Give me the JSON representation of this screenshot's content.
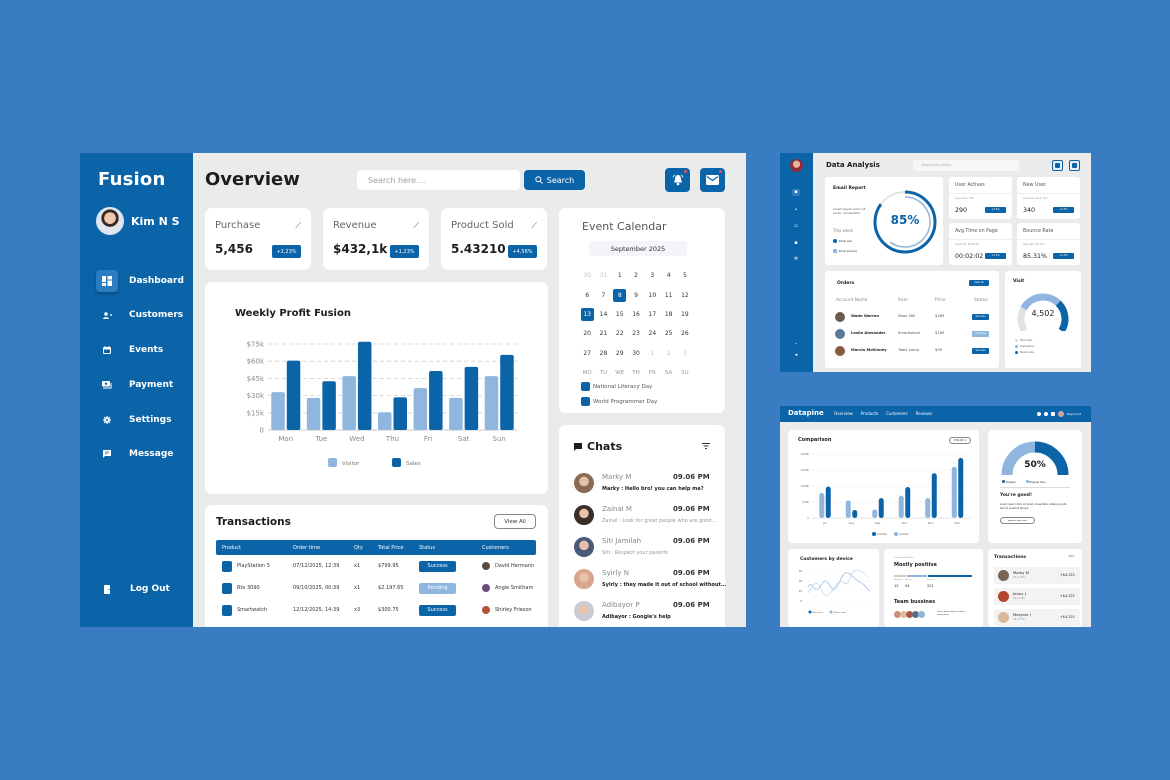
{
  "colors": {
    "background": "#3a7cc2",
    "primary": "#0b63a8",
    "light_blue": "#8fb6de",
    "panel": "#ebebeb",
    "pending": "#8fb6de"
  },
  "main": {
    "brand": "Fusion",
    "user": {
      "name": "Kim N S"
    },
    "sidebar": {
      "items": [
        {
          "label": "Dashboard",
          "icon": "dashboard-icon",
          "active": true
        },
        {
          "label": "Customers",
          "icon": "users-icon"
        },
        {
          "label": "Events",
          "icon": "calendar-icon"
        },
        {
          "label": "Payment",
          "icon": "payment-icon"
        },
        {
          "label": "Settings",
          "icon": "gear-icon"
        },
        {
          "label": "Message",
          "icon": "message-icon"
        }
      ],
      "logout": "Log Out"
    },
    "header": {
      "title": "Overview",
      "search_placeholder": "Search here....",
      "search_button": "Search",
      "notification_icon": "bell-icon",
      "mail_icon": "mail-icon"
    },
    "stats": [
      {
        "label": "Purchase",
        "value": "5,456",
        "badge": "+2,23%"
      },
      {
        "label": "Revenue",
        "value": "$432,1k",
        "badge": "+1,23%"
      },
      {
        "label": "Product Sold",
        "value": "5.43210",
        "badge": "+4,56%"
      }
    ],
    "calendar": {
      "title": "Event Calendar",
      "month": "September 2025",
      "weeks": [
        [
          {
            "d": "30",
            "m": true
          },
          {
            "d": "31",
            "m": true
          },
          {
            "d": "1"
          },
          {
            "d": "2"
          },
          {
            "d": "3"
          },
          {
            "d": "4"
          },
          {
            "d": "5"
          }
        ],
        [
          {
            "d": "6"
          },
          {
            "d": "7"
          },
          {
            "d": "8",
            "s": true
          },
          {
            "d": "9"
          },
          {
            "d": "10"
          },
          {
            "d": "11"
          },
          {
            "d": "12"
          }
        ],
        [
          {
            "d": "13",
            "s": true
          },
          {
            "d": "14"
          },
          {
            "d": "15"
          },
          {
            "d": "16"
          },
          {
            "d": "17"
          },
          {
            "d": "18"
          },
          {
            "d": "19"
          }
        ],
        [
          {
            "d": "20"
          },
          {
            "d": "21"
          },
          {
            "d": "22"
          },
          {
            "d": "23"
          },
          {
            "d": "24"
          },
          {
            "d": "25"
          },
          {
            "d": "26"
          }
        ],
        [
          {
            "d": "27"
          },
          {
            "d": "28"
          },
          {
            "d": "29"
          },
          {
            "d": "30"
          },
          {
            "d": "1",
            "m": true
          },
          {
            "d": "2",
            "m": true
          },
          {
            "d": "3",
            "m": true
          }
        ]
      ],
      "weekdays": [
        "MO",
        "TU",
        "WE",
        "TH",
        "FR",
        "SA",
        "SU"
      ],
      "events": [
        "National Literacy Day",
        "World Programmer Day"
      ]
    },
    "chats": {
      "title": "Chats",
      "items": [
        {
          "name": "Marky M",
          "time": "09.06 PM",
          "message": "Marky : Hello bro! you can help me?",
          "unread": true,
          "avatar": "#8a6b55"
        },
        {
          "name": "Zainal M",
          "time": "09.06 PM",
          "message": "Zainal : Look for great people who are good...",
          "unread": false,
          "avatar": "#3b2e2a"
        },
        {
          "name": "Siti Jamilah",
          "time": "09.06 PM",
          "message": "Siti : Respect your parents",
          "unread": false,
          "avatar": "#4a5a78"
        },
        {
          "name": "Syirly N",
          "time": "09.06 PM",
          "message": "Syirly : they made it out of school without ...",
          "unread": true,
          "avatar": "#d9a58f"
        },
        {
          "name": "Adibayor P",
          "time": "09.06 PM",
          "message": "Adibayor : Google's help",
          "unread": true,
          "avatar": "#c9ccd2"
        }
      ]
    },
    "transactions": {
      "title": "Transactions",
      "view_all": "View All",
      "columns": [
        "Product",
        "Order time",
        "Qty",
        "Total Price",
        "Status",
        "Customers"
      ],
      "rows": [
        {
          "product": "PlayStation 5",
          "time": "07/12/2025, 12:39",
          "qty": "x1",
          "price": "$799.95",
          "status": "Success",
          "customer": "David Hermann",
          "cust_color": "#5b4a40"
        },
        {
          "product": "Rtx 3090",
          "time": "09/10/2025, 00:39",
          "qty": "x1",
          "price": "$2.197.65",
          "status": "Pending",
          "customer": "Angie Smitham",
          "cust_color": "#6b4d7a"
        },
        {
          "product": "Smartwatch",
          "time": "12/12/2025, 14:39",
          "qty": "x3",
          "price": "$300.75",
          "status": "Success",
          "customer": "Shirley Frieson",
          "cust_color": "#b5533a"
        }
      ]
    }
  },
  "chart_data": [
    {
      "type": "bar",
      "title": "Weekly Profit Fusion",
      "categories": [
        "Mon",
        "Tue",
        "Wed",
        "Thu",
        "Fri",
        "Sat",
        "Sun"
      ],
      "series": [
        {
          "name": "Visitor",
          "color": "#8fb6de",
          "values": [
            33,
            28,
            47,
            15.5,
            36.5,
            28,
            47
          ]
        },
        {
          "name": "Sales",
          "color": "#0b63a8",
          "values": [
            60.5,
            42.5,
            77,
            28.5,
            51.5,
            55,
            65.5
          ]
        }
      ],
      "y_ticks": [
        "0",
        "$15k",
        "$30k",
        "$45k",
        "$60k",
        "$75k"
      ],
      "ylim": [
        0,
        75
      ],
      "yunit": "$k",
      "grid": true,
      "legend": "bottom"
    },
    {
      "type": "bar",
      "title": "Comparison",
      "categories": [
        "Jul",
        "Aug",
        "Sep",
        "Oct",
        "Nov",
        "Dec"
      ],
      "series": [
        {
          "name": "Last Year",
          "color": "#8fb6de",
          "values": [
            78,
            55,
            27,
            70,
            62,
            160
          ]
        },
        {
          "name": "This Year",
          "color": "#0b63a8",
          "values": [
            98,
            25,
            62,
            97,
            140,
            188
          ]
        }
      ],
      "y_ticks": [
        "0",
        "$50k",
        "$100k",
        "$150k",
        "$200k"
      ],
      "ylim": [
        0,
        200
      ],
      "grid": true,
      "legend": "bottom"
    }
  ],
  "data_analysis": {
    "title": "Data Analysis",
    "search_placeholder": "Search anything...",
    "email": {
      "title": "Email Report",
      "desc": "Lorem ipsum dolor sit amet, consectetur",
      "week": "This week",
      "percent": "85%",
      "progress": 0.85,
      "legend": [
        "Email sent",
        "Email pending"
      ]
    },
    "stats": [
      {
        "title": "User Actives",
        "sub": "Avg.users: 320",
        "value": "290",
        "badge": "+2.3%"
      },
      {
        "title": "New User",
        "sub": "Avg.new users: 354",
        "value": "340",
        "badge": "+2.3%"
      },
      {
        "title": "Avg.Time on Page",
        "sub": "Avg.time: 00:03:05",
        "value": "00:02:02",
        "badge": "+2.3%"
      },
      {
        "title": "Bounce Rate",
        "sub": "Avg.rate: 85.31%",
        "value": "85.31%",
        "badge": "+2.3%"
      }
    ],
    "orders": {
      "title": "Orders",
      "button": "View All",
      "columns": [
        "Account Name",
        "Item",
        "Price",
        "Status"
      ],
      "rows": [
        {
          "name": "Wade Warren",
          "item": "Xbox 360",
          "price": "$489",
          "status": "Success",
          "color": "#6a5a4f"
        },
        {
          "name": "Leslie Alexander",
          "item": "Smartwatch",
          "price": "$189",
          "status": "Pending",
          "color": "#5a7a9a"
        },
        {
          "name": "Marvin McKinney",
          "item": "Table Lamp",
          "price": "$99",
          "status": "Success",
          "color": "#8a5a45"
        }
      ]
    },
    "visit": {
      "title": "Visit",
      "value": "4,502",
      "legend": [
        "Total users",
        "Impressions",
        "Bounce rate"
      ]
    }
  },
  "datapine": {
    "logo": "Datapine",
    "nav": [
      "Overview",
      "Products",
      "Customers",
      "Reviews"
    ],
    "user": "Raymond",
    "comparison_select": "6 Month",
    "gauge": {
      "percent": "50%",
      "value": 0.5,
      "legend": [
        "Progress",
        "Progress done"
      ],
      "title": "You're good!",
      "desc": "Lorem ipsum dolor sit amet, consectetur adipiscing elit. Sed do eiusmod tempor.",
      "button": "Improve your score"
    },
    "device": {
      "title": "Customers by device",
      "y_ticks": [
        "0",
        "15",
        "30",
        "45"
      ],
      "legend": [
        "Web sales",
        "Offline sales"
      ]
    },
    "sentiment": {
      "caption": "Customer feedback",
      "title": "Mostly positive",
      "labels": [
        "Negative",
        "Neutral",
        "Positive"
      ],
      "values": [
        "12",
        "54",
        "221"
      ]
    },
    "team": {
      "title": "Team bussines",
      "desc": "Lorem ipsum dolor sit amet, consectetur"
    },
    "transactions": {
      "title": "Transactions",
      "items": [
        {
          "name": "Marky M",
          "time": "06.21 PM",
          "amount": "+$4.321",
          "color": "#7a6455"
        },
        {
          "name": "Jenny J",
          "time": "06.21 PM",
          "amount": "+$4.321",
          "color": "#b4462e"
        },
        {
          "name": "Maryam I",
          "time": "06.21 PM",
          "amount": "+$4.321",
          "color": "#d8b79c"
        }
      ]
    }
  }
}
